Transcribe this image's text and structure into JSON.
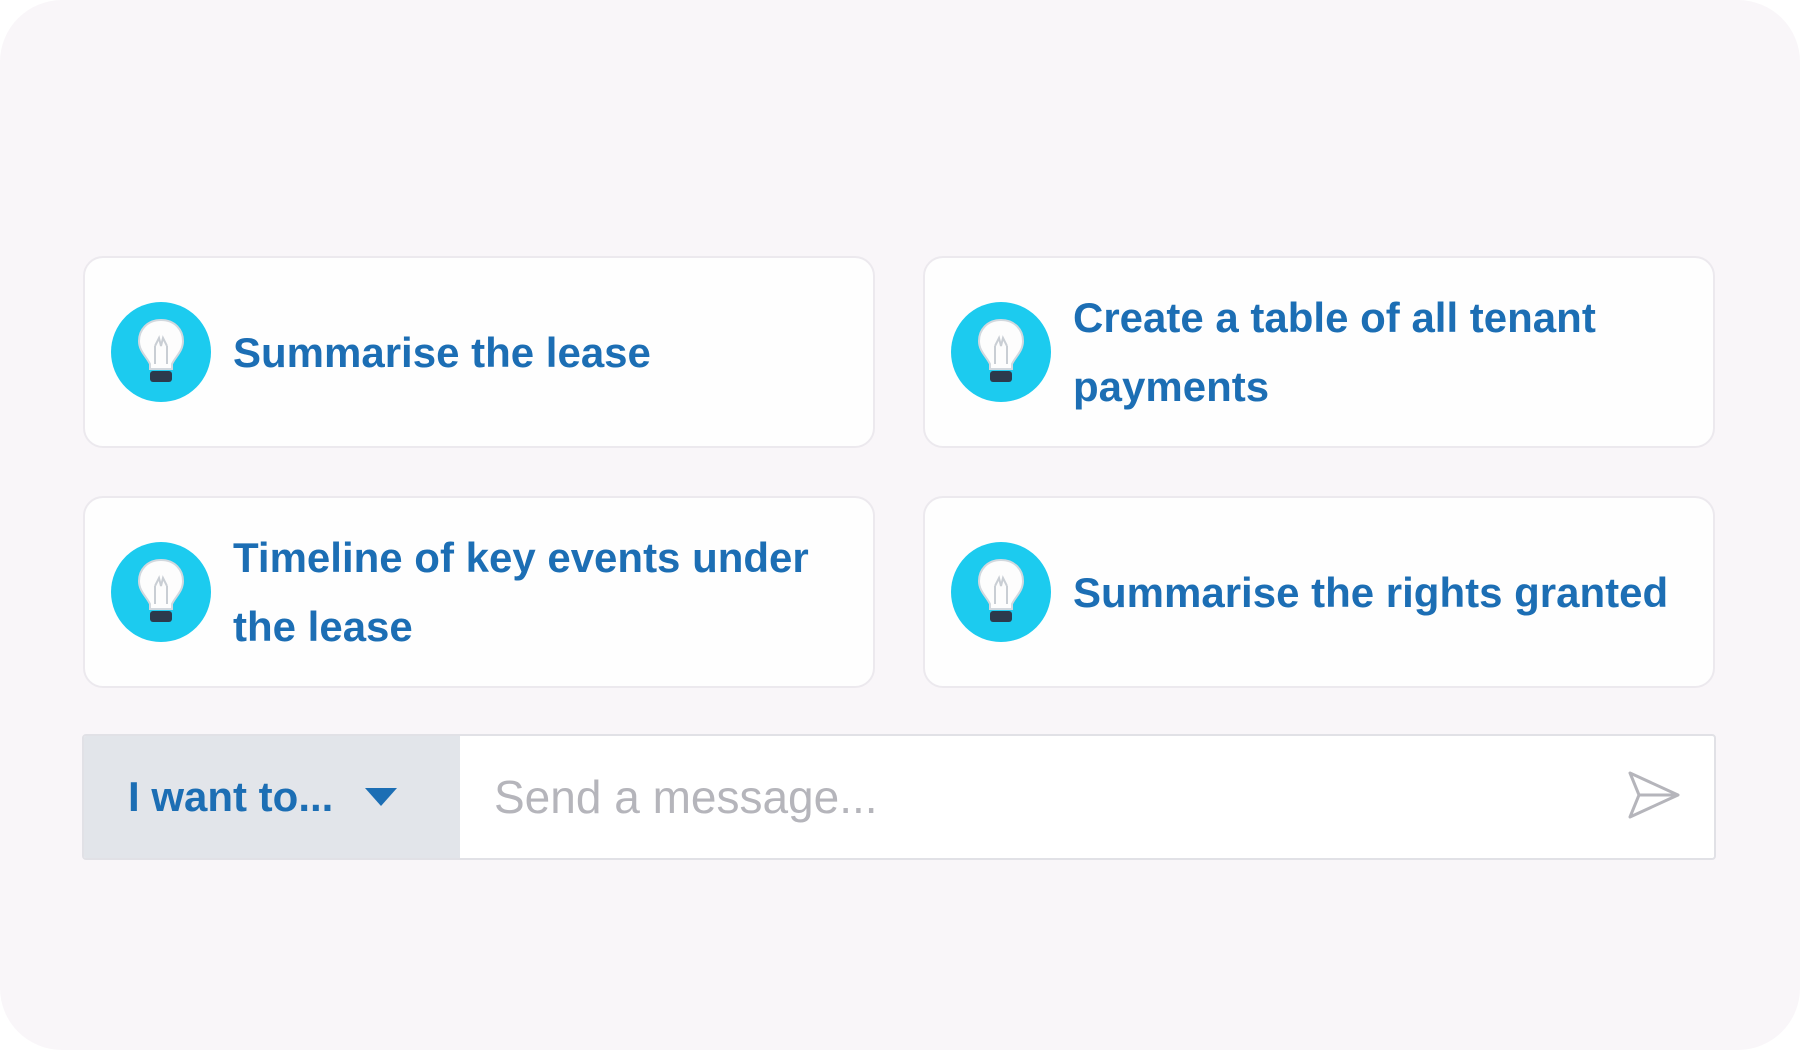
{
  "suggestions": [
    {
      "icon": "lightbulb-icon",
      "label": "Summarise the lease"
    },
    {
      "icon": "lightbulb-icon",
      "label": "Create a table of all tenant payments"
    },
    {
      "icon": "lightbulb-icon",
      "label": "Timeline of key events under the lease"
    },
    {
      "icon": "lightbulb-icon",
      "label": "Summarise the rights granted"
    }
  ],
  "composer": {
    "intent_label": "I want to...",
    "intent_icon": "caret-down-icon",
    "message_placeholder": "Send a message...",
    "message_value": "",
    "send_icon": "send-icon"
  },
  "colors": {
    "accent_text": "#1c6eb4",
    "bulb_background": "#1ccbef",
    "panel_background": "#f9f6f9",
    "intent_background": "#e2e5ea"
  }
}
